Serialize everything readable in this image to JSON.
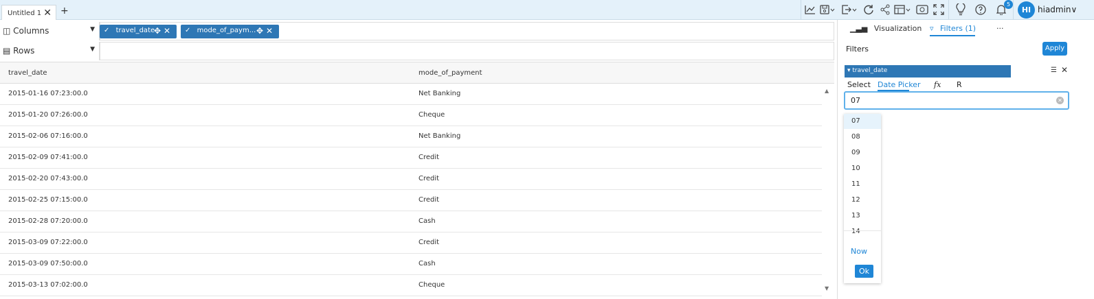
{
  "window": {
    "tab_label": "Untitled 1",
    "close_glyph": "✕",
    "add_tab_glyph": "+"
  },
  "toolbar": {
    "icons": [
      "line-chart-icon",
      "save-icon",
      "export-icon",
      "refresh-icon",
      "share-icon",
      "layout-icon",
      "view-icon",
      "fullscreen-icon",
      "bulb-icon",
      "help-icon",
      "bell-icon"
    ],
    "notification_count": "5",
    "avatar_initials": "HI",
    "username": "hiadmin∨"
  },
  "shelves": {
    "columns_label": "Columns",
    "rows_label": "Rows",
    "column_pills": [
      "travel_date",
      "mode_of_paym..."
    ]
  },
  "grid": {
    "headers": [
      "travel_date",
      "mode_of_payment"
    ],
    "rows": [
      [
        "2015-01-16 07:23:00.0",
        "Net Banking"
      ],
      [
        "2015-01-20 07:26:00.0",
        "Cheque"
      ],
      [
        "2015-02-06 07:16:00.0",
        "Net Banking"
      ],
      [
        "2015-02-09 07:41:00.0",
        "Credit"
      ],
      [
        "2015-02-20 07:43:00.0",
        "Credit"
      ],
      [
        "2015-02-25 07:15:00.0",
        "Credit"
      ],
      [
        "2015-02-28 07:20:00.0",
        "Cash"
      ],
      [
        "2015-03-09 07:22:00.0",
        "Credit"
      ],
      [
        "2015-03-09 07:50:00.0",
        "Cash"
      ],
      [
        "2015-03-13 07:02:00.0",
        "Cheque"
      ]
    ]
  },
  "panel": {
    "tab_visualization": "Visualization",
    "tab_filters": "Filters (1)",
    "more": "···",
    "filters_title": "Filters",
    "apply_label": "Apply",
    "filter_field": "travel_date",
    "subtabs": [
      "Select",
      "Date Picker",
      "fx",
      "R"
    ],
    "input_value": "07",
    "options": [
      "07",
      "08",
      "09",
      "10",
      "11",
      "12",
      "13",
      "14"
    ],
    "now_label": "Now",
    "ok_label": "Ok"
  },
  "colors": {
    "accent": "#1f86d6",
    "pill": "#2e77b5",
    "topbar": "#e4f1fa"
  }
}
